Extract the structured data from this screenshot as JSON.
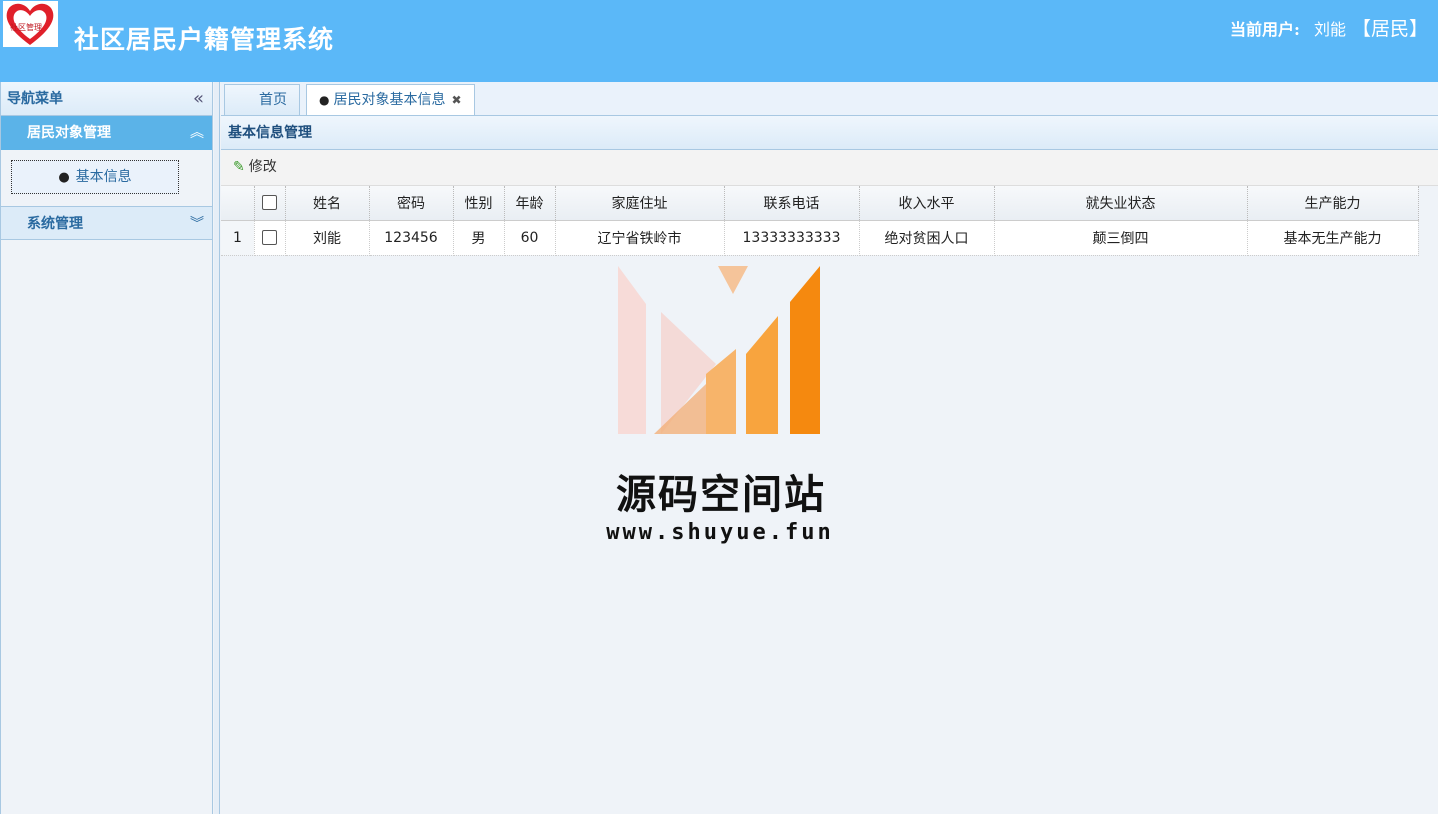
{
  "header": {
    "logo_text": "社区管理",
    "app_title": "社区居民户籍管理系统",
    "user_label": "当前用户:",
    "user_name": "刘能",
    "user_role": "【居民】"
  },
  "sidebar": {
    "title": "导航菜单",
    "groups": [
      {
        "label": "居民对象管理",
        "expanded": true,
        "items": [
          {
            "label": "基本信息",
            "icon": "person-icon"
          }
        ]
      },
      {
        "label": "系统管理",
        "expanded": false,
        "items": []
      }
    ]
  },
  "tabs": [
    {
      "label": "首页",
      "active": false
    },
    {
      "label": "居民对象基本信息",
      "active": true,
      "icon": "person-icon",
      "closable": true
    }
  ],
  "panel": {
    "title": "基本信息管理",
    "toolbar": {
      "edit_label": "修改",
      "edit_icon": "pencil-icon"
    }
  },
  "table": {
    "columns": [
      "姓名",
      "密码",
      "性别",
      "年龄",
      "家庭住址",
      "联系电话",
      "收入水平",
      "就失业状态",
      "生产能力"
    ],
    "rows": [
      {
        "index": "1",
        "cells": [
          "刘能",
          "123456",
          "男",
          "60",
          "辽宁省铁岭市",
          "13333333333",
          "绝对贫困人口",
          "颠三倒四",
          "基本无生产能力"
        ]
      }
    ]
  },
  "watermark": {
    "title": "源码空间站",
    "url": "www.shuyue.fun"
  },
  "colors": {
    "header_bg": "#5bb8f8",
    "active_group_bg": "#5bb3e8",
    "watermark_orange": "#f5890f"
  }
}
